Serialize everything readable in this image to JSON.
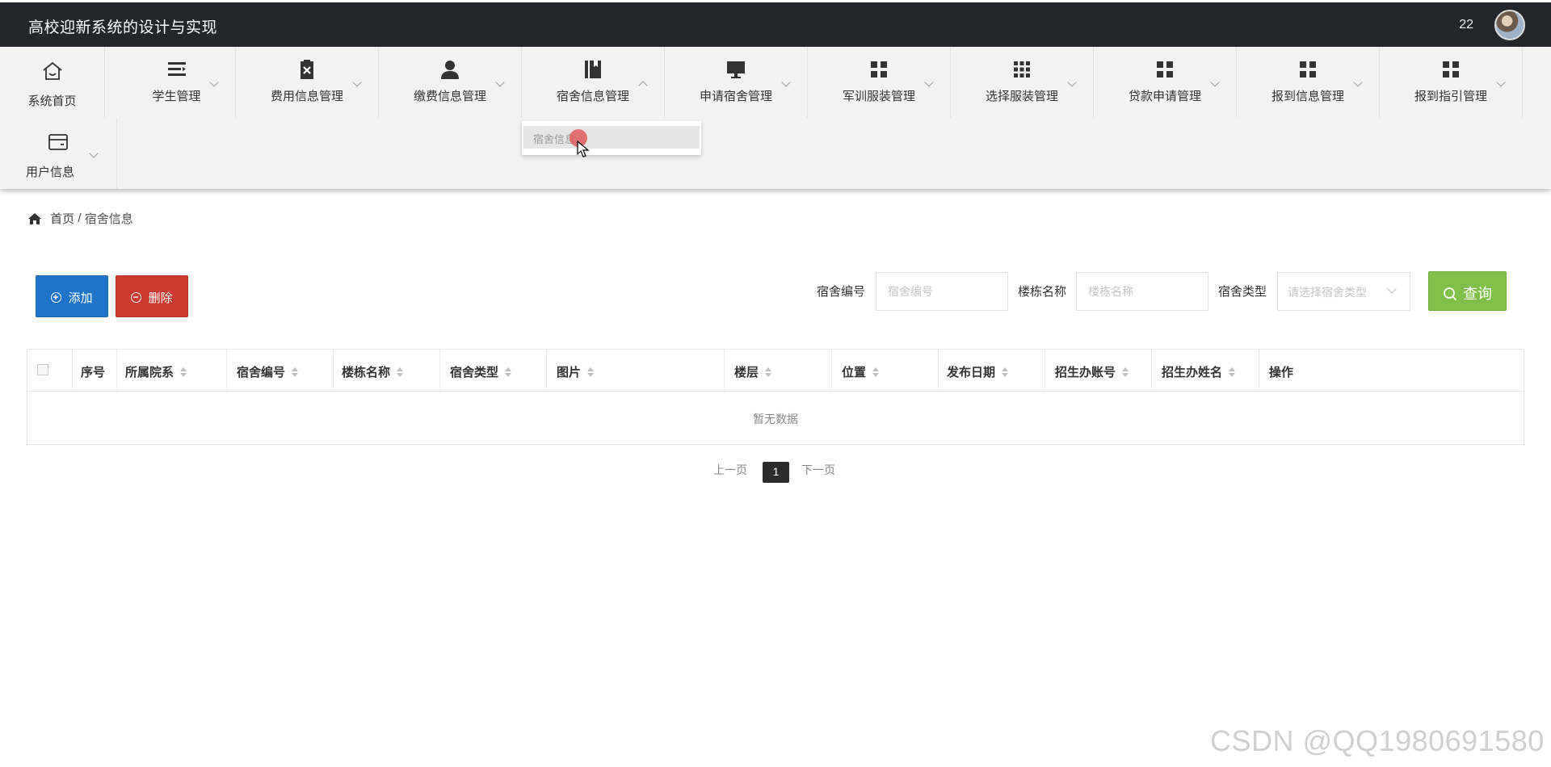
{
  "header": {
    "app_title": "高校迎新系统的设计与实现",
    "user_name": "22"
  },
  "nav": {
    "home": "系统首页",
    "items": [
      {
        "label": "学生管理",
        "icon": "list-icon"
      },
      {
        "label": "费用信息管理",
        "icon": "clipboard-x-icon"
      },
      {
        "label": "缴费信息管理",
        "icon": "user-icon"
      },
      {
        "label": "宿舍信息管理",
        "icon": "book-icon"
      },
      {
        "label": "申请宿舍管理",
        "icon": "monitor-icon"
      },
      {
        "label": "军训服装管理",
        "icon": "grid-icon"
      },
      {
        "label": "选择服装管理",
        "icon": "grid-9-icon"
      },
      {
        "label": "贷款申请管理",
        "icon": "grid-icon"
      },
      {
        "label": "报到信息管理",
        "icon": "grid-icon"
      },
      {
        "label": "报到指引管理",
        "icon": "grid-icon"
      }
    ],
    "user_info": "用户信息",
    "dropdown_item": "宿舍信息"
  },
  "breadcrumb": {
    "home": "首页",
    "separator": "/",
    "current": "宿舍信息"
  },
  "toolbar": {
    "add_label": "添加",
    "delete_label": "删除",
    "query_label": "查询"
  },
  "search": {
    "room_no_label": "宿舍编号",
    "room_no_placeholder": "宿舍编号",
    "building_label": "楼栋名称",
    "building_placeholder": "楼栋名称",
    "type_label": "宿舍类型",
    "type_placeholder": "请选择宿舍类型"
  },
  "table": {
    "columns": [
      "序号",
      "所属院系",
      "宿舍编号",
      "楼栋名称",
      "宿舍类型",
      "图片",
      "楼层",
      "位置",
      "发布日期",
      "招生办账号",
      "招生办姓名",
      "操作"
    ],
    "empty_text": "暂无数据"
  },
  "pagination": {
    "prev": "上一页",
    "current": "1",
    "next": "下一页"
  },
  "watermark": "CSDN @QQ1980691580",
  "colors": {
    "header_bg": "#23272c",
    "add_button": "#1f74c9",
    "delete_button": "#c93a31",
    "query_button": "#7ec04a"
  }
}
